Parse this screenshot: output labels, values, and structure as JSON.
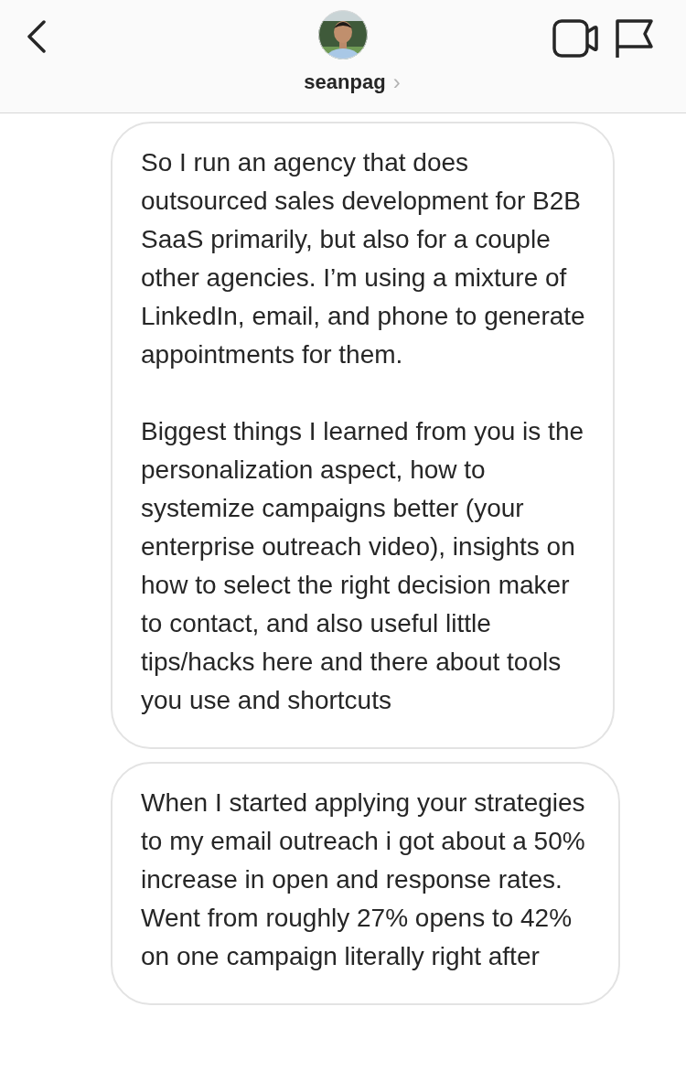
{
  "header": {
    "username": "seanpag",
    "chevron": "›"
  },
  "messages": [
    {
      "paragraphs": [
        "So I run an agency that does outsourced sales development for B2B SaaS primarily, but also for a couple other agencies. I’m using a mixture of LinkedIn, email, and phone to generate appointments for them.",
        "Biggest things I learned from you is the personalization aspect, how to systemize campaigns better (your enterprise outreach video), insights on how to select the right decision maker to contact, and also useful little tips/hacks here and there about tools you use and shortcuts"
      ]
    },
    {
      "paragraphs": [
        "When I started applying your strategies to my email outreach i got about a 50% increase in open and response rates. Went from roughly 27% opens to 42% on one campaign literally right after"
      ]
    }
  ]
}
